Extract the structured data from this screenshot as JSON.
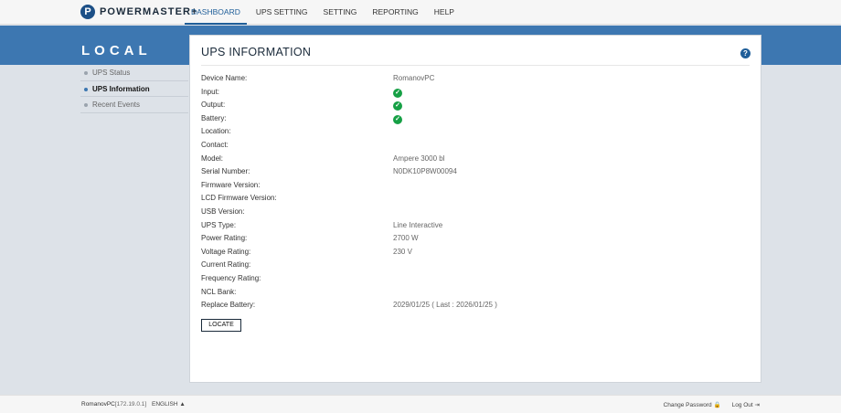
{
  "brand": {
    "logo_letter": "P",
    "name": "POWERMASTER+"
  },
  "nav": [
    {
      "label": "DASHBOARD",
      "active": true
    },
    {
      "label": "UPS SETTING"
    },
    {
      "label": "SETTING"
    },
    {
      "label": "REPORTING"
    },
    {
      "label": "HELP"
    }
  ],
  "section_title": "LOCAL",
  "sidebar": [
    {
      "label": "UPS Status"
    },
    {
      "label": "UPS Information",
      "active": true
    },
    {
      "label": "Recent Events"
    }
  ],
  "panel": {
    "title": "UPS INFORMATION",
    "help_icon": "?",
    "rows": [
      {
        "label": "Device Name:",
        "value": "RomanovPC"
      },
      {
        "label": "Input:",
        "value": "",
        "status": "ok"
      },
      {
        "label": "Output:",
        "value": "",
        "status": "ok"
      },
      {
        "label": "Battery:",
        "value": "",
        "status": "ok"
      },
      {
        "label": "Location:",
        "value": ""
      },
      {
        "label": "Contact:",
        "value": ""
      },
      {
        "label": "Model:",
        "value": "Ampere 3000 bl"
      },
      {
        "label": "Serial Number:",
        "value": "N0DK10P8W00094"
      },
      {
        "label": "Firmware Version:",
        "value": ""
      },
      {
        "label": "LCD Firmware Version:",
        "value": ""
      },
      {
        "label": "USB Version:",
        "value": ""
      },
      {
        "label": "UPS Type:",
        "value": "Line Interactive"
      },
      {
        "label": "Power Rating:",
        "value": "2700 W"
      },
      {
        "label": "Voltage Rating:",
        "value": "230 V"
      },
      {
        "label": "Current Rating:",
        "value": ""
      },
      {
        "label": "Frequency Rating:",
        "value": ""
      },
      {
        "label": "NCL Bank:",
        "value": ""
      },
      {
        "label": "Replace Battery:",
        "value": "2029/01/25 ( Last : 2026/01/25 )"
      }
    ],
    "locate_label": "LOCATE"
  },
  "footer": {
    "host": "RomanovPC",
    "ip": "[172.19.0.1]",
    "language": "ENGLISH",
    "language_arrow": "▲",
    "change_password": "Change Password",
    "lock_icon": "🔒",
    "log_out": "Log Out",
    "logout_icon": "⇥"
  },
  "colors": {
    "accent": "#3d77b1",
    "nav_active": "#1f5e99",
    "ok": "#16a045"
  }
}
